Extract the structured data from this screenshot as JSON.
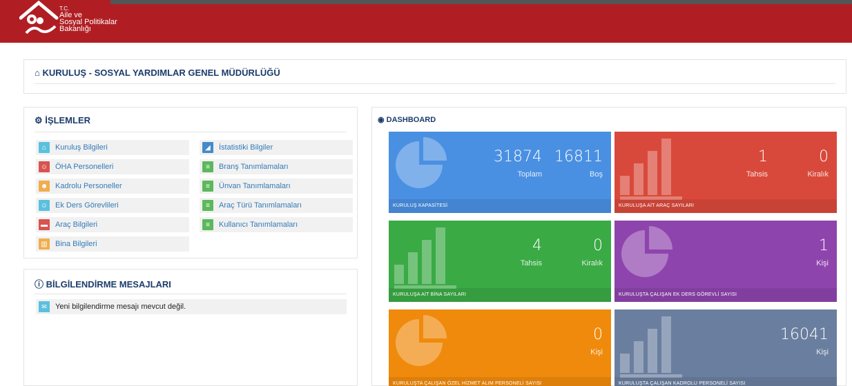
{
  "header": {
    "logo_line1": "T.C.",
    "logo_line2": "Aile ve",
    "logo_line3": "Sosyal Politikalar",
    "logo_line4": "Bakanlığı"
  },
  "title": "KURULUŞ - SOSYAL YARDIMLAR GENEL MÜDÜRLÜĞÜ",
  "islemler": {
    "heading": "İŞLEMLER",
    "left": [
      {
        "label": "Kuruluş Bilgileri",
        "icon": "home-icon",
        "color": "#5bc0de"
      },
      {
        "label": "ÖHA Personelleri",
        "icon": "user-icon",
        "color": "#d9534f"
      },
      {
        "label": "Kadrolu Personeller",
        "icon": "users-icon",
        "color": "#f0ad4e"
      },
      {
        "label": "Ek Ders Görevlileri",
        "icon": "user-icon",
        "color": "#5bc0de"
      },
      {
        "label": "Araç Bilgileri",
        "icon": "car-icon",
        "color": "#d9534f"
      },
      {
        "label": "Bina Bilgileri",
        "icon": "building-icon",
        "color": "#f0ad4e"
      }
    ],
    "right": [
      {
        "label": "İstatistiki Bilgiler",
        "icon": "chart-icon",
        "color": "#428bca"
      },
      {
        "label": "Branş Tanımlamaları",
        "icon": "list-icon",
        "color": "#5cb85c"
      },
      {
        "label": "Ünvan Tanımlamaları",
        "icon": "list-icon",
        "color": "#5cb85c"
      },
      {
        "label": "Araç Türü Tanımlamaları",
        "icon": "list-icon",
        "color": "#5cb85c"
      },
      {
        "label": "Kullanıcı Tanımlamaları",
        "icon": "list-icon",
        "color": "#5cb85c"
      }
    ]
  },
  "messages": {
    "heading": "BİLGİLENDİRME MESAJLARI",
    "text": "Yeni bilgilendirme mesajı mevcut değil."
  },
  "dashboard": {
    "heading": "DASHBOARD",
    "tiles": [
      {
        "color": "#4a90e2",
        "deco": "pie",
        "footer": "KURULUŞ KAPASİTESİ",
        "values": [
          {
            "num": "31874",
            "label": "Toplam"
          },
          {
            "num": "16811",
            "label": "Boş"
          }
        ]
      },
      {
        "color": "#d9493b",
        "deco": "bar",
        "footer": "KURULUŞA AİT ARAÇ SAYILARI",
        "values": [
          {
            "num": "1",
            "label": "Tahsis"
          },
          {
            "num": "0",
            "label": "Kiralık"
          }
        ]
      },
      {
        "color": "#3aaa45",
        "deco": "bar",
        "footer": "KURULUŞA AİT BİNA SAYILARI",
        "values": [
          {
            "num": "4",
            "label": "Tahsis"
          },
          {
            "num": "0",
            "label": "Kiralık"
          }
        ]
      },
      {
        "color": "#8e44ad",
        "deco": "pie",
        "footer": "KURULUŞTA ÇALIŞAN EK DERS GÖREVLİ SAYISI",
        "values": [
          {
            "num": "1",
            "label": "Kişi"
          }
        ]
      },
      {
        "color": "#f08a0c",
        "deco": "pie",
        "footer": "KURULUŞTA ÇALIŞAN ÖZEL HİZMET ALIM PERSONELİ SAYISI",
        "values": [
          {
            "num": "0",
            "label": "Kişi"
          }
        ]
      },
      {
        "color": "#6a7f9f",
        "deco": "bar",
        "footer": "KURULUŞTA ÇALIŞAN KADROLU PERSONELİ SAYISI",
        "values": [
          {
            "num": "16041",
            "label": "Kişi"
          }
        ]
      }
    ]
  }
}
